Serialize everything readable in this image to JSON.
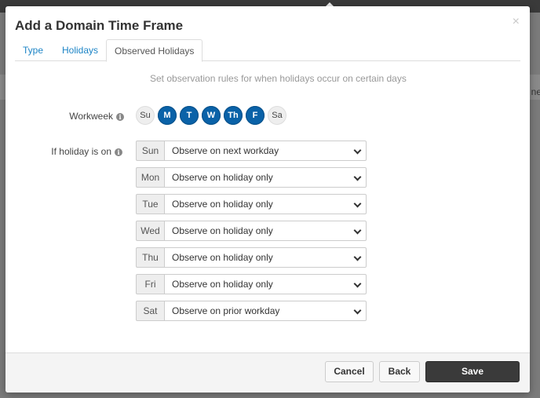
{
  "background": {
    "partial_text": "ne"
  },
  "modal": {
    "title": "Add a Domain Time Frame",
    "close_glyph": "×"
  },
  "tabs": [
    {
      "label": "Type",
      "active": false
    },
    {
      "label": "Holidays",
      "active": false
    },
    {
      "label": "Observed Holidays",
      "active": true
    }
  ],
  "subtitle": "Set observation rules for when holidays occur on certain days",
  "workweek": {
    "label": "Workweek",
    "days": [
      {
        "label": "Su",
        "selected": false
      },
      {
        "label": "M",
        "selected": true
      },
      {
        "label": "T",
        "selected": true
      },
      {
        "label": "W",
        "selected": true
      },
      {
        "label": "Th",
        "selected": true
      },
      {
        "label": "F",
        "selected": true
      },
      {
        "label": "Sa",
        "selected": false
      }
    ]
  },
  "if_holiday": {
    "label": "If holiday is on",
    "rows": [
      {
        "day": "Sun",
        "value": "Observe on next workday"
      },
      {
        "day": "Mon",
        "value": "Observe on holiday only"
      },
      {
        "day": "Tue",
        "value": "Observe on holiday only"
      },
      {
        "day": "Wed",
        "value": "Observe on holiday only"
      },
      {
        "day": "Thu",
        "value": "Observe on holiday only"
      },
      {
        "day": "Fri",
        "value": "Observe on holiday only"
      },
      {
        "day": "Sat",
        "value": "Observe on prior workday"
      }
    ]
  },
  "footer": {
    "cancel_label": "Cancel",
    "back_label": "Back",
    "save_label": "Save"
  },
  "colors": {
    "accent": "#0a62a8",
    "link": "#1c84c6",
    "primary_button": "#3a3a3a"
  },
  "icons": {
    "info": "info-icon",
    "close": "close-icon",
    "dropdown": "chevron-down-icon"
  }
}
